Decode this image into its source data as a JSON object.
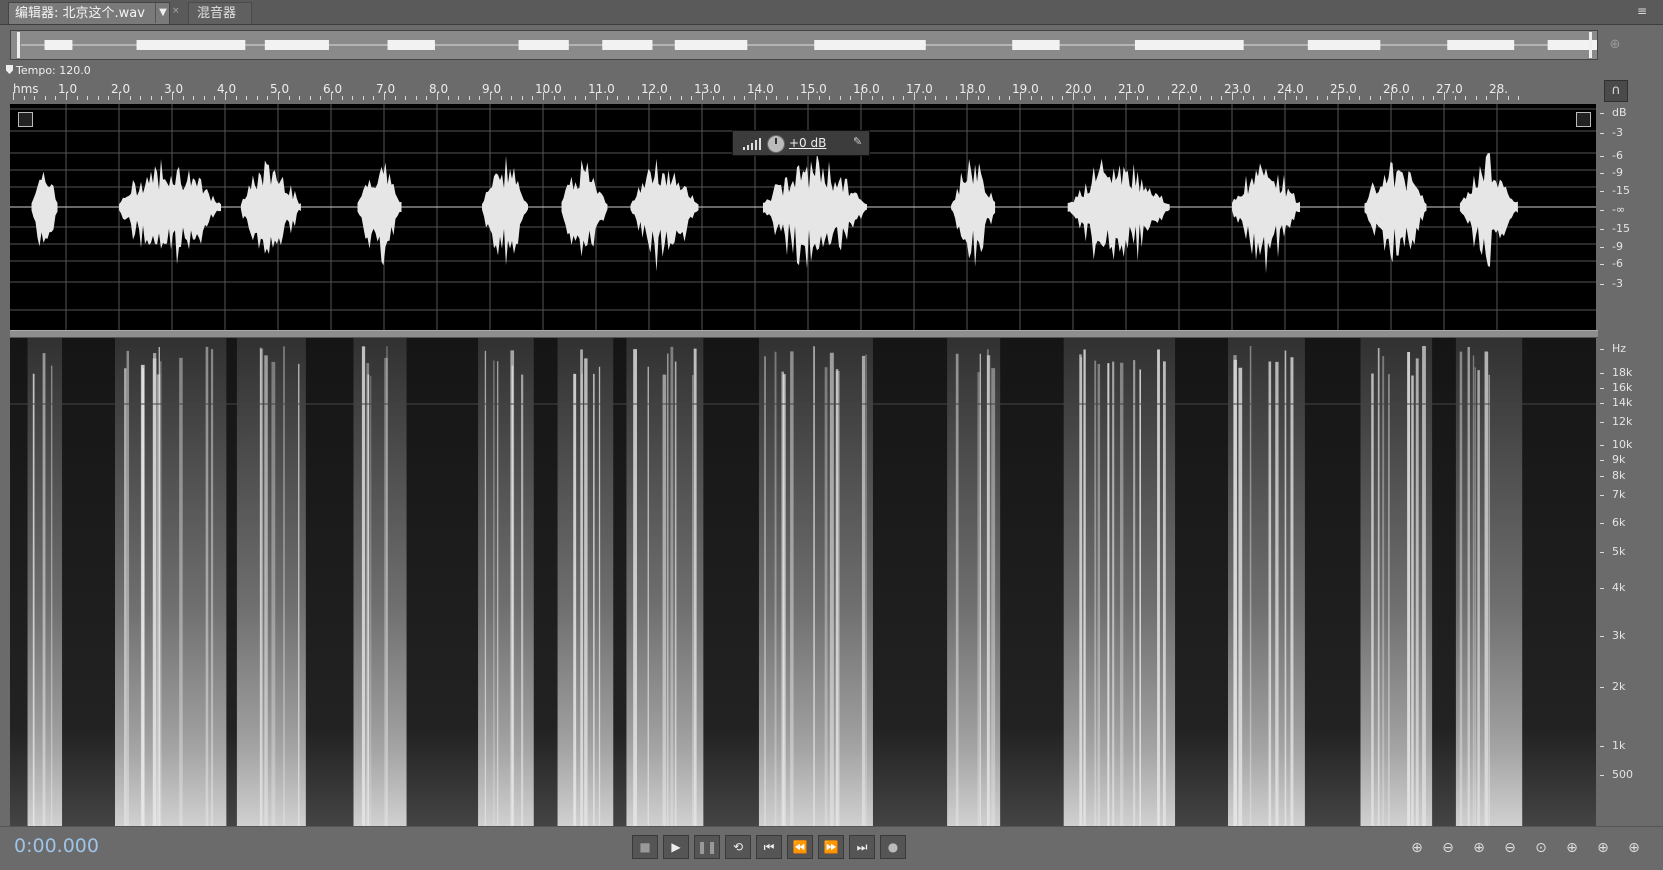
{
  "tabs": {
    "editor_label": "编辑器: 北京这个.wav",
    "editor_dropdown": "▼",
    "editor_close": "×",
    "mixer_label": "混音器",
    "panel_menu": "≡"
  },
  "tempo_label": "Tempo: 120.0",
  "ruler": {
    "unit": "hms",
    "ticks": [
      "1.0",
      "2.0",
      "3.0",
      "4.0",
      "5.0",
      "6.0",
      "7.0",
      "8.0",
      "9.0",
      "10.0",
      "11.0",
      "12.0",
      "13.0",
      "14.0",
      "15.0",
      "16.0",
      "17.0",
      "18.0",
      "19.0",
      "20.0",
      "21.0",
      "22.0",
      "23.0",
      "24.0",
      "25.0",
      "26.0",
      "27.0",
      "28."
    ]
  },
  "hud": {
    "gain": "+0 dB"
  },
  "db_scale": [
    "dB",
    "-3",
    "-6",
    "-9",
    "-15",
    "-∞",
    "-15",
    "-9",
    "-6",
    "-3"
  ],
  "hz_scale": [
    "Hz",
    "18k",
    "16k",
    "14k",
    "12k",
    "10k",
    "9k",
    "8k",
    "7k",
    "6k",
    "5k",
    "4k",
    "3k",
    "2k",
    "1k",
    "500"
  ],
  "time_display": "0:00.000",
  "transport": [
    {
      "name": "stop-button",
      "icon": "■"
    },
    {
      "name": "play-button",
      "icon": "▶"
    },
    {
      "name": "pause-button",
      "icon": "❚❚"
    },
    {
      "name": "loop-button",
      "icon": "⟲"
    },
    {
      "name": "go-to-start-button",
      "icon": "⏮"
    },
    {
      "name": "rewind-button",
      "icon": "⏪"
    },
    {
      "name": "fast-forward-button",
      "icon": "⏩"
    },
    {
      "name": "go-to-end-button",
      "icon": "⏭"
    },
    {
      "name": "record-button",
      "icon": "●"
    }
  ],
  "zoom_tools": [
    {
      "name": "zoom-in-amplitude-icon",
      "icon": "⊕"
    },
    {
      "name": "zoom-out-amplitude-icon",
      "icon": "⊖"
    },
    {
      "name": "zoom-in-time-icon",
      "icon": "⊕"
    },
    {
      "name": "zoom-out-time-icon",
      "icon": "⊖"
    },
    {
      "name": "zoom-full-icon",
      "icon": "⊙"
    },
    {
      "name": "zoom-in-left-icon",
      "icon": "⊕"
    },
    {
      "name": "zoom-in-right-icon",
      "icon": "⊕"
    },
    {
      "name": "zoom-selection-icon",
      "icon": "⊕"
    }
  ],
  "audio": {
    "segments_seconds": [
      [
        0.35,
        0.85
      ],
      [
        2.0,
        3.95
      ],
      [
        4.3,
        5.45
      ],
      [
        6.5,
        7.35
      ],
      [
        8.85,
        9.75
      ],
      [
        10.35,
        11.25
      ],
      [
        11.65,
        12.95
      ],
      [
        14.15,
        16.15
      ],
      [
        17.7,
        18.55
      ],
      [
        19.9,
        21.85
      ],
      [
        23.0,
        24.3
      ],
      [
        25.5,
        26.7
      ],
      [
        27.3,
        28.4
      ]
    ],
    "duration_seconds": 28.4
  }
}
